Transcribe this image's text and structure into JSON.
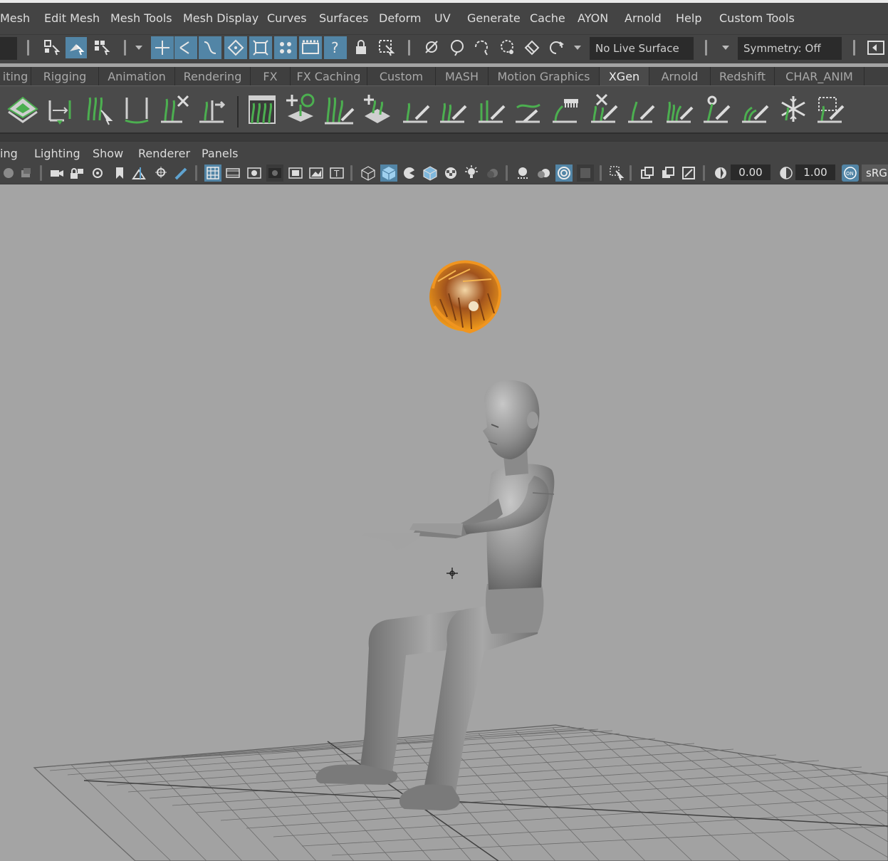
{
  "menubar": {
    "items": [
      "Mesh",
      "Edit Mesh",
      "Mesh Tools",
      "Mesh Display",
      "Curves",
      "Surfaces",
      "Deform",
      "UV",
      "Generate",
      "Cache",
      "AYON",
      "Arnold",
      "Help",
      "Custom Tools"
    ]
  },
  "statusline": {
    "live_surface": "No Live Surface",
    "symmetry": "Symmetry: Off"
  },
  "shelf": {
    "tabs": [
      "iting",
      "Rigging",
      "Animation",
      "Rendering",
      "FX",
      "FX Caching",
      "Custom",
      "MASH",
      "Motion Graphics",
      "XGen",
      "Arnold",
      "Redshift",
      "CHAR_ANIM"
    ],
    "active_tab": "XGen",
    "icons": [
      "xgen-description-icon",
      "xgen-move-guides-icon",
      "xgen-select-guides-icon",
      "xgen-guide-length-icon",
      "xgen-delete-guides-icon",
      "xgen-transfer-guides-icon",
      "xgen-interactive-groom-icon",
      "xgen-add-guide-icon",
      "xgen-sculpt-grass-icon",
      "xgen-place-icon",
      "xgen-brush-1-icon",
      "xgen-brush-2-icon",
      "xgen-brush-3-icon",
      "xgen-brush-4-icon",
      "xgen-comb-icon",
      "xgen-cut-icon",
      "xgen-brush-5-icon",
      "xgen-brush-6-icon",
      "xgen-brush-7-icon",
      "xgen-brush-8-icon",
      "xgen-freeze-icon",
      "xgen-brush-9-icon"
    ]
  },
  "panel": {
    "menu": [
      "ing",
      "Lighting",
      "Show",
      "Renderer",
      "Panels"
    ],
    "exposure": "0.00",
    "gamma": "1.00",
    "on_label": "ON",
    "colorspace": "sRGB"
  },
  "colors": {
    "accent": "#5285a6",
    "xgen_green": "#4caf50",
    "viewport": "#a4a4a4",
    "hair": "#e58a1a"
  }
}
